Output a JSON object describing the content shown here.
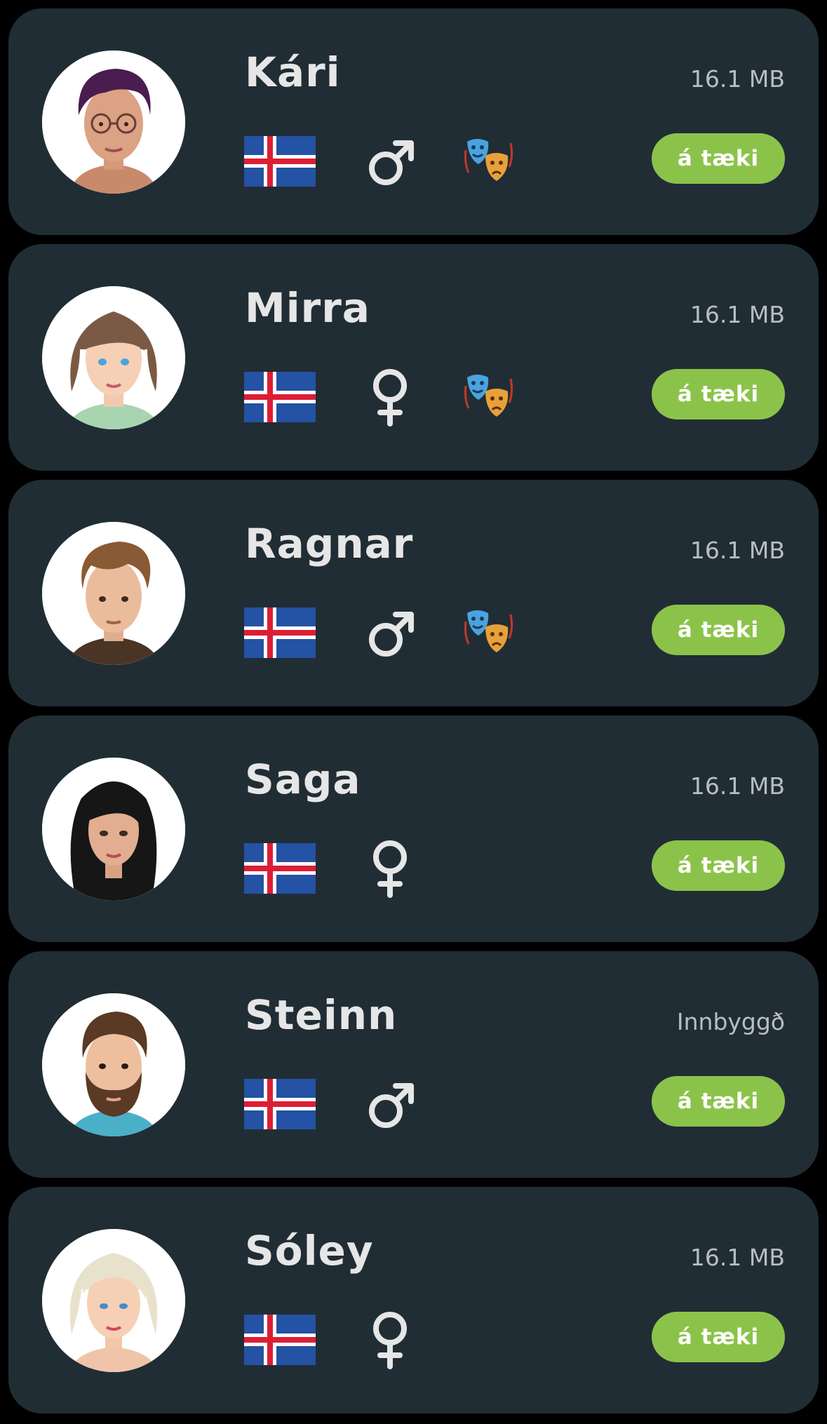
{
  "voices": [
    {
      "name": "Kári",
      "size": "16.1 MB",
      "gender": "male",
      "gender_icon": "male-icon",
      "flag_icon": "iceland-flag-icon",
      "has_expressive": true,
      "expressive_icon": "theater-masks-icon",
      "action_label": "á tæki",
      "avatar_icon": "avatar-male-glasses"
    },
    {
      "name": "Mirra",
      "size": "16.1 MB",
      "gender": "female",
      "gender_icon": "female-icon",
      "flag_icon": "iceland-flag-icon",
      "has_expressive": true,
      "expressive_icon": "theater-masks-icon",
      "action_label": "á tæki",
      "avatar_icon": "avatar-female-brown-hair"
    },
    {
      "name": "Ragnar",
      "size": "16.1 MB",
      "gender": "male",
      "gender_icon": "male-icon",
      "flag_icon": "iceland-flag-icon",
      "has_expressive": true,
      "expressive_icon": "theater-masks-icon",
      "action_label": "á tæki",
      "avatar_icon": "avatar-male-brown-hair"
    },
    {
      "name": "Saga",
      "size": "16.1 MB",
      "gender": "female",
      "gender_icon": "female-icon",
      "flag_icon": "iceland-flag-icon",
      "has_expressive": false,
      "action_label": "á tæki",
      "avatar_icon": "avatar-female-black-hair"
    },
    {
      "name": "Steinn",
      "size": "Innbyggð",
      "gender": "male",
      "gender_icon": "male-icon",
      "flag_icon": "iceland-flag-icon",
      "has_expressive": false,
      "action_label": "á tæki",
      "avatar_icon": "avatar-male-beard"
    },
    {
      "name": "Sóley",
      "size": "16.1 MB",
      "gender": "female",
      "gender_icon": "female-icon",
      "flag_icon": "iceland-flag-icon",
      "has_expressive": false,
      "action_label": "á tæki",
      "avatar_icon": "avatar-female-blonde"
    }
  ],
  "colors": {
    "background": "#000000",
    "card": "#212d35",
    "name_text": "#e6e6e6",
    "size_text": "#b8bec2",
    "button": "#8bc34a",
    "button_text": "#ffffff",
    "flag_blue": "#2452a4",
    "flag_white": "#ffffff",
    "flag_red": "#dc1e35"
  }
}
